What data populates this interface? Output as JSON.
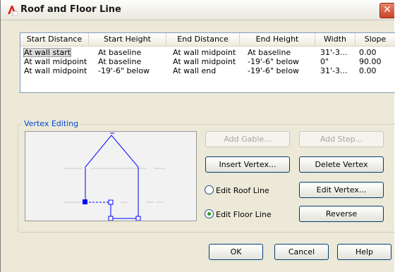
{
  "window": {
    "title": "Roof and Floor Line",
    "close_glyph": "✕"
  },
  "list": {
    "columns": [
      "Start Distance",
      "Start Height",
      "End Distance",
      "End Height",
      "Width",
      "Slope"
    ],
    "rows": [
      [
        "At wall start",
        "At baseline",
        "At wall midpoint",
        "At baseline",
        "31'-3...",
        "0.00"
      ],
      [
        "At wall midpoint",
        "At baseline",
        "At wall midpoint",
        "-19'-6\" below",
        "0\"",
        "90.00"
      ],
      [
        "At wall midpoint",
        "-19'-6\" below",
        "At wall end",
        "-19'-6\" below",
        "31'-3...",
        "0.00"
      ]
    ],
    "selected_row": 0
  },
  "vertex_editing": {
    "group_label": "Vertex Editing",
    "add_gable": "Add Gable...",
    "add_step": "Add Step...",
    "insert_vertex": "Insert Vertex...",
    "delete_vertex": "Delete Vertex",
    "edit_vertex": "Edit Vertex...",
    "reverse": "Reverse",
    "edit_roof_line": "Edit Roof Line",
    "edit_floor_line": "Edit Floor Line",
    "selected_mode": "Edit Floor Line"
  },
  "footer": {
    "ok": "OK",
    "cancel": "Cancel",
    "help": "Help"
  },
  "colors": {
    "accent": "#0046d5",
    "preview_line": "#0000ff",
    "dialog_bg": "#ece9d8"
  }
}
